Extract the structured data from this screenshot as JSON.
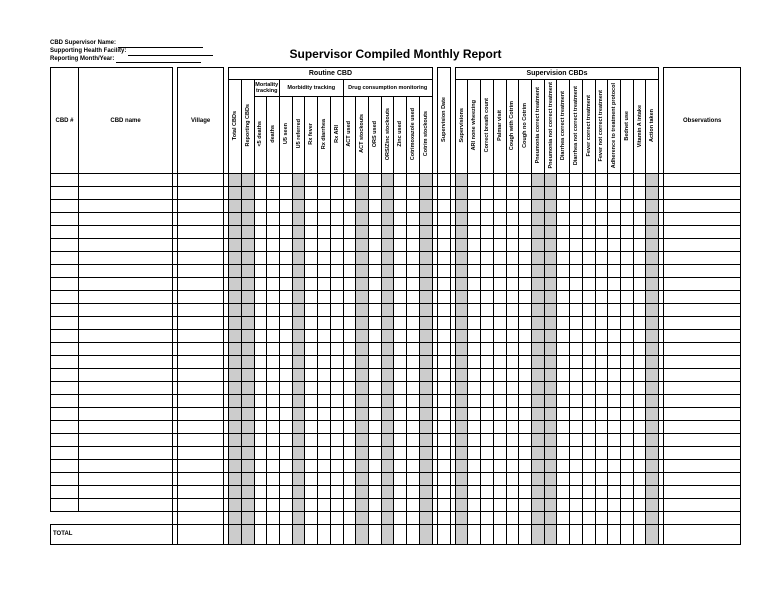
{
  "header": {
    "field1_label": "CBD Supervisor Name:",
    "field2_label": "Supporting Health Facility:",
    "field3_label": "Reporting Month/Year:"
  },
  "title": "Supervisor Compiled Monthly Report",
  "groups": {
    "routine": "Routine CBD",
    "supervision": "Supervision CBDs",
    "mortality": "Mortality tracking",
    "morbidity": "Morbidity tracking",
    "drug": "Drug consumption monitoring"
  },
  "cols": {
    "cbd_num": "CBD #",
    "cbd_name": "CBD name",
    "village": "Village",
    "total_cbds": "Total CBDs",
    "reporting_cbds": "Reporting CBDs",
    "lt5_deaths": "<5 deaths",
    "deaths": "deaths",
    "u5_seen": "U5 seen",
    "u5_referred": "U5 referred",
    "rx_fever": "Rx fever",
    "rx_diarrhea": "Rx diarrhea",
    "rx_ari": "Rx ARI",
    "act_used": "ACT used",
    "act_stockouts": "ACT stockouts",
    "ors_used": "ORS used",
    "ors_zinc_stockouts": "ORS/Zinc stockouts",
    "zinc_used": "Zinc used",
    "cotrim_used": "Cotrimoxazole used",
    "cotrim_stockouts": "Cotrim stockouts",
    "supervision_date": "Supervision Date",
    "supervisions": "Supervisions",
    "ari_none_wheezing": "ARI none wheezing",
    "correct_breath": "Correct breath count",
    "palmar_visit": "Palmar visit",
    "cough_with_cotrim": "Cough with Cotrim",
    "cough_no_cotrim": "Cough no Cotrim",
    "pneumonia_correct": "Pneumonia correct treatment",
    "pneumonia_not": "Pneumonia  not correct treatment",
    "diarrhea_correct": "Diarrhea correct treatment",
    "diarrhea_not": "Diarrhea  not correct treatment",
    "fever_correct": "Fever correct treatment",
    "fever_not": "Fever not correct treatment",
    "adherence": "Adherence to treatment protocol",
    "bednet_use": "Bednet use",
    "vitamin_a": "Vitamin A intake",
    "action_taken": "Action taken",
    "observations": "Observations"
  },
  "total_label": "TOTAL",
  "chart_data": {
    "type": "table",
    "title": "Supervisor Compiled Monthly Report",
    "rows": 28,
    "columns_identity": [
      "CBD #",
      "CBD name",
      "Village"
    ],
    "columns_routine": [
      "Total CBDs",
      "Reporting CBDs",
      "<5 deaths",
      "deaths",
      "U5 seen",
      "U5 referred",
      "Rx fever",
      "Rx diarrhea",
      "Rx ARI",
      "ACT used",
      "ACT stockouts",
      "ORS used",
      "ORS/Zinc stockouts",
      "Zinc used",
      "Cotrimoxazole used",
      "Cotrim stockouts"
    ],
    "supervision_date": "Supervision Date",
    "columns_supervision": [
      "Supervisions",
      "ARI none wheezing",
      "Correct breath count",
      "Palmar visit",
      "Cough with Cotrim",
      "Cough no Cotrim",
      "Pneumonia correct treatment",
      "Pneumonia not correct treatment",
      "Diarrhea correct treatment",
      "Diarrhea not correct treatment",
      "Fever correct treatment",
      "Fever not correct treatment",
      "Adherence to treatment protocol",
      "Bednet use",
      "Vitamin A intake",
      "Action taken"
    ],
    "observations_column": "Observations",
    "values": []
  }
}
